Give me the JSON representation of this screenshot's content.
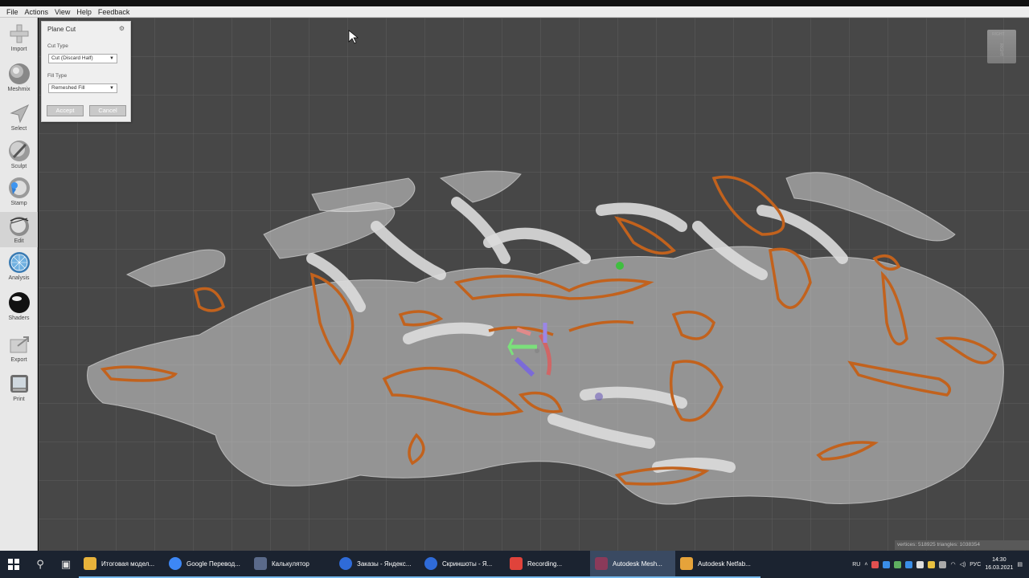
{
  "menu": {
    "items": [
      "File",
      "Actions",
      "View",
      "Help",
      "Feedback"
    ]
  },
  "toolbar": {
    "tools": [
      {
        "label": "Import",
        "icon": "plus-icon"
      },
      {
        "label": "Meshmix",
        "icon": "meshmix-icon"
      },
      {
        "label": "Select",
        "icon": "select-arrow-icon"
      },
      {
        "label": "Sculpt",
        "icon": "sculpt-brush-icon"
      },
      {
        "label": "Stamp",
        "icon": "stamp-icon"
      },
      {
        "label": "Edit",
        "icon": "edit-icon"
      },
      {
        "label": "Analysis",
        "icon": "analysis-icon"
      },
      {
        "label": "Shaders",
        "icon": "shaders-sphere-icon"
      },
      {
        "label": "Export",
        "icon": "export-icon"
      },
      {
        "label": "Print",
        "icon": "print-icon"
      }
    ],
    "active": "Edit"
  },
  "panel": {
    "title": "Plane Cut",
    "cut_type_label": "Cut Type",
    "cut_type_value": "Cut (Discard Half)",
    "fill_type_label": "Fill Type",
    "fill_type_value": "Remeshed Fill",
    "accept_label": "Accept",
    "cancel_label": "Cancel"
  },
  "viewcube": {
    "top": "RIGHT",
    "face": "RIGHT"
  },
  "status": {
    "text": "vertices: 518925 triangles: 1038354"
  },
  "taskbar": {
    "apps": [
      {
        "label": "Итоговая модел...",
        "color": "#e8b33b",
        "icon": "folder-icon"
      },
      {
        "label": "Google Перевод...",
        "color": "#3d87f5",
        "icon": "chrome-icon"
      },
      {
        "label": "Калькулятор",
        "color": "#5a6a8a",
        "icon": "calculator-icon"
      },
      {
        "label": "Заказы - Яндекс...",
        "color": "#2f6bd8",
        "icon": "browser-icon"
      },
      {
        "label": "Скриншоты - Я...",
        "color": "#2f6bd8",
        "icon": "browser-icon"
      },
      {
        "label": "Recording...",
        "color": "#e0433b",
        "icon": "recording-icon"
      },
      {
        "label": "Autodesk Mesh...",
        "color": "#8a3a5a",
        "icon": "meshmixer-icon"
      },
      {
        "label": "Autodesk Netfab...",
        "color": "#e6a33a",
        "icon": "netfabb-icon"
      }
    ],
    "active_app": "Autodesk Mesh...",
    "lang1": "RU",
    "lang2": "РУС",
    "time": "14:30",
    "date": "16.03.2021"
  },
  "colors": {
    "viewport": "#474747",
    "cut_outline": "#c2621d",
    "mesh": "#cfcfcf"
  }
}
